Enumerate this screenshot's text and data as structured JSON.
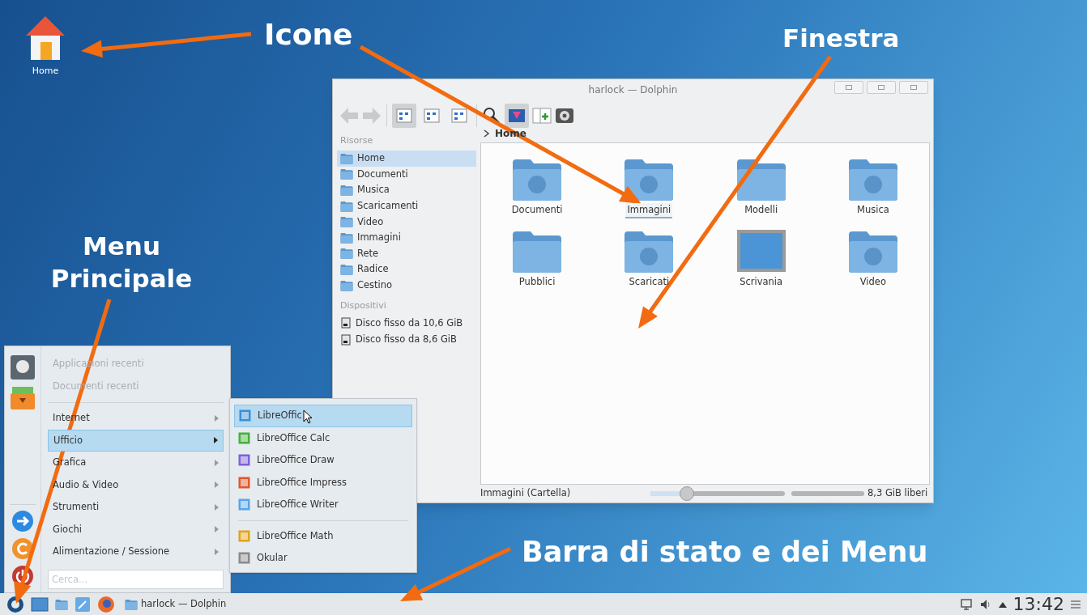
{
  "desktop_icons": [
    {
      "label": "Home"
    }
  ],
  "annotations": [
    {
      "text": "Icone"
    },
    {
      "text": "Finestra"
    },
    {
      "text": "Menu Principale"
    },
    {
      "text": "Barra di stato e dei Menu"
    }
  ],
  "window": {
    "title": "harlock — Dolphin",
    "view_modes": [
      {
        "selected": true
      },
      {
        "selected": false
      },
      {
        "selected": false
      }
    ],
    "preview_on": true,
    "places": {
      "heading": "Risorse",
      "items": [
        {
          "label": "Home",
          "selected": true
        },
        {
          "label": "Documenti",
          "selected": false
        },
        {
          "label": "Musica",
          "selected": false
        },
        {
          "label": "Scaricamenti",
          "selected": false
        },
        {
          "label": "Video",
          "selected": false
        },
        {
          "label": "Immagini",
          "selected": false
        },
        {
          "label": "Rete",
          "selected": false
        },
        {
          "label": "Radice",
          "selected": false
        },
        {
          "label": "Cestino",
          "selected": false
        }
      ]
    },
    "devices": {
      "heading": "Dispositivi",
      "items": [
        {
          "label": "Disco fisso da 10,6 GiB"
        },
        {
          "label": "Disco fisso da 8,6 GiB"
        }
      ]
    },
    "breadcrumb": "Home",
    "folders": [
      {
        "label": "Documenti",
        "kind": "documents",
        "selected": false
      },
      {
        "label": "Immagini",
        "kind": "pictures",
        "selected": true
      },
      {
        "label": "Modelli",
        "kind": "plain",
        "selected": false
      },
      {
        "label": "Musica",
        "kind": "music",
        "selected": false
      },
      {
        "label": "Pubblici",
        "kind": "plain",
        "selected": false
      },
      {
        "label": "Scaricati",
        "kind": "downloads",
        "selected": false
      },
      {
        "label": "Scrivania",
        "kind": "desktop",
        "selected": false
      },
      {
        "label": "Video",
        "kind": "video",
        "selected": false
      }
    ],
    "status_text": "Immagini (Cartella)",
    "zoom": {
      "level": 0.27
    },
    "free_space": {
      "level": 1,
      "text": "8,3 GiB liberi"
    }
  },
  "menu": {
    "recent": [
      {
        "label": "Applicazioni recenti",
        "disabled": true
      },
      {
        "label": "Documenti recenti",
        "disabled": true
      }
    ],
    "categories": [
      {
        "label": "Internet",
        "selected": false
      },
      {
        "label": "Ufficio",
        "selected": true
      },
      {
        "label": "Grafica",
        "selected": false
      },
      {
        "label": "Audio & Video",
        "selected": false
      },
      {
        "label": "Strumenti",
        "selected": false
      },
      {
        "label": "Giochi",
        "selected": false
      },
      {
        "label": "Alimentazione / Sessione",
        "selected": false
      }
    ],
    "search": {
      "placeholder": "Cerca..."
    },
    "submenu": [
      {
        "kind": "app",
        "label": "LibreOffic",
        "color": "#3a8fd8",
        "selected": true
      },
      {
        "kind": "app",
        "label": "LibreOffice Calc",
        "color": "#45b03c",
        "selected": false
      },
      {
        "kind": "app",
        "label": "LibreOffice Draw",
        "color": "#7d62d8",
        "selected": false
      },
      {
        "kind": "app",
        "label": "LibreOffice Impress",
        "color": "#e0572b",
        "selected": false
      },
      {
        "kind": "app",
        "label": "LibreOffice Writer",
        "color": "#5aa6e8",
        "selected": false
      },
      {
        "kind": "separator"
      },
      {
        "kind": "app",
        "label": "LibreOffice Math",
        "color": "#e3a21a",
        "selected": false
      },
      {
        "kind": "app",
        "label": "Okular",
        "color": "#8a8a8a",
        "selected": false
      }
    ]
  },
  "taskbar": {
    "task": "harlock — Dolphin",
    "clock": "13:42"
  }
}
